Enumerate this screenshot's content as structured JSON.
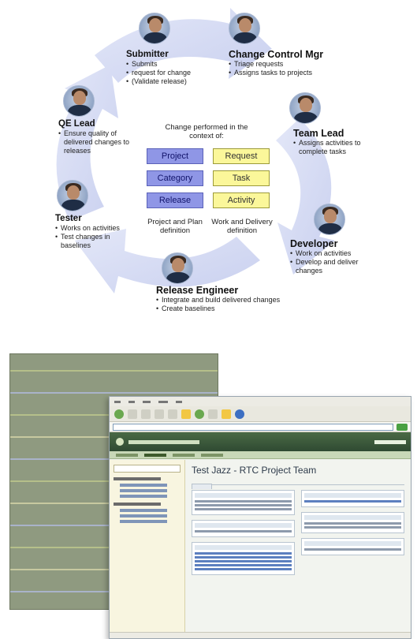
{
  "roles": {
    "submitter": {
      "name": "Submitter",
      "bullets": [
        "Submits",
        "request for change",
        "(Validate release)"
      ]
    },
    "change_control_mgr": {
      "name": "Change Control Mgr",
      "bullets": [
        "Triage requests",
        "Assigns tasks to projects"
      ]
    },
    "team_lead": {
      "name": "Team Lead",
      "bullets": [
        "Assigns activities to complete tasks"
      ]
    },
    "developer": {
      "name": "Developer",
      "bullets": [
        "Work on activities",
        "Develop and deliver changes"
      ]
    },
    "release_engineer": {
      "name": "Release Engineer",
      "bullets": [
        "Integrate and build delivered changes",
        "Create baselines"
      ]
    },
    "tester": {
      "name": "Tester",
      "bullets": [
        "Works on activities",
        "Test changes in baselines"
      ]
    },
    "qe_lead": {
      "name": "QE Lead",
      "bullets": [
        "Ensure quality of delivered changes to releases"
      ]
    }
  },
  "center": {
    "context_label": "Change performed in the context of:",
    "left_boxes": [
      "Project",
      "Category",
      "Release"
    ],
    "right_boxes": [
      "Request",
      "Task",
      "Activity"
    ],
    "left_label": "Project and Plan definition",
    "right_label": "Work and Delivery definition"
  },
  "screenshot": {
    "project_title": "Test Jazz - RTC Project Team"
  },
  "colors": {
    "arrow": "#d7dcf3",
    "blue_box": "#8f96e6",
    "yellow_box": "#fbf79a"
  }
}
